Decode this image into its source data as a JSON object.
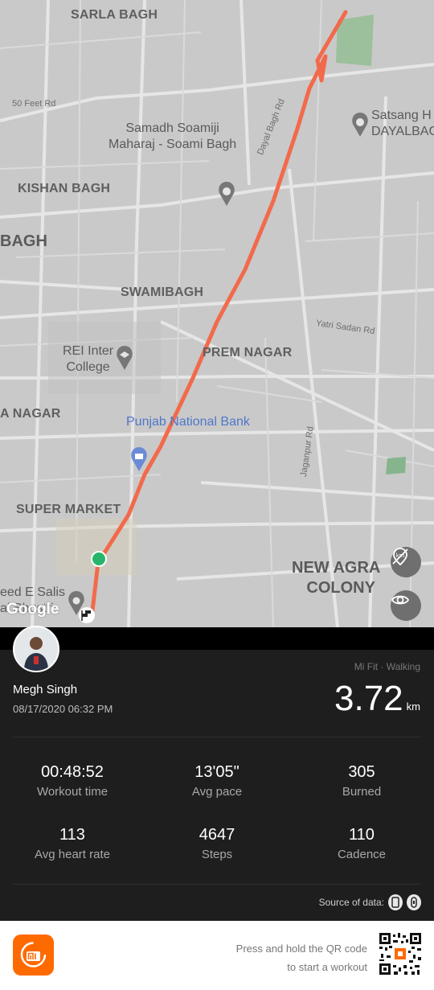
{
  "map": {
    "areas": {
      "sarla_bagh": "SARLA BAGH",
      "kishan_bagh": "KISHAN BAGH",
      "bagh": "BAGH",
      "swamibagh": "SWAMIBAGH",
      "prem_nagar": "PREM NAGAR",
      "a_nagar": "A NAGAR",
      "super_market": "SUPER MARKET",
      "new_agra_1": "NEW AGRA",
      "new_agra_2": "COLONY"
    },
    "pois": {
      "samadh_1": "Samadh Soamiji",
      "samadh_2": "Maharaj - Soami Bagh",
      "satsang_1": "Satsang H",
      "satsang_2": "DAYALBAG",
      "rei_1": "REI Inter",
      "rei_2": "College",
      "pnb": "Punjab National Bank",
      "shaheed_1": "eed E Salis",
      "shaheed_2": "al Shustri"
    },
    "roads": {
      "feet50": "50 Feet Rd",
      "dayalbagh": "Dayal Bagh Rd",
      "yatri": "Yatri Sadan Rd",
      "jaganpur": "Jaganpur Rd"
    },
    "google_logo": "Google"
  },
  "workout": {
    "user_name": "Megh Singh",
    "date_time": "08/17/2020 06:32 PM",
    "source_label": "Mi Fit · Walking",
    "distance": "3.72",
    "distance_unit": "km",
    "stats": [
      {
        "value": "00:48:52",
        "label": "Workout time"
      },
      {
        "value": "13'05\"",
        "label": "Avg pace"
      },
      {
        "value": "305",
        "label": "Burned"
      },
      {
        "value": "113",
        "label": "Avg heart rate"
      },
      {
        "value": "4647",
        "label": "Steps"
      },
      {
        "value": "110",
        "label": "Cadence"
      }
    ],
    "source_of_data": "Source of data:"
  },
  "footer": {
    "qr_line1": "Press and hold the QR code",
    "qr_line2": "to start a workout"
  },
  "colors": {
    "route": "#f26a4b",
    "start": "#25b66b",
    "accent": "#ff6a00"
  }
}
